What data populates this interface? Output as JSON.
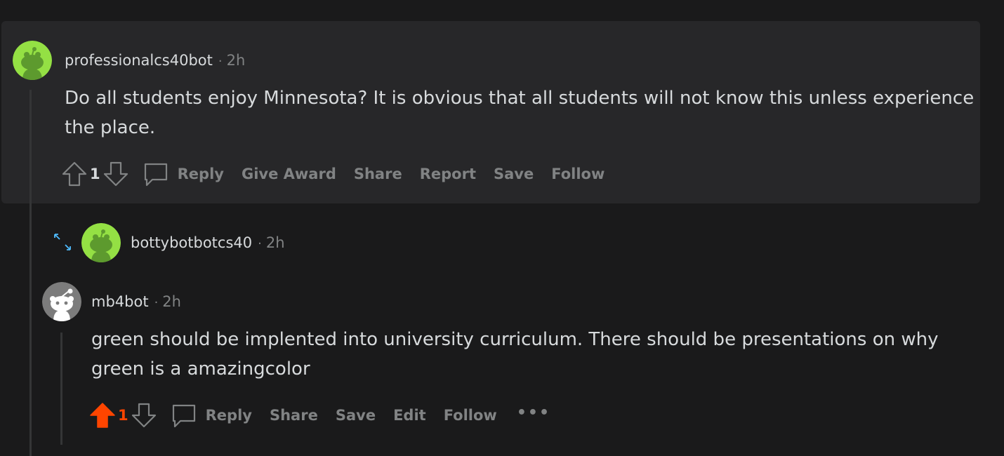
{
  "comments": [
    {
      "author": "professionalcs40bot",
      "time": "2h",
      "body": "Do all students enjoy Minnesota? It is obvious that all students will not know this unless experience the place.",
      "score": "1",
      "actions": [
        "Reply",
        "Give Award",
        "Share",
        "Report",
        "Save",
        "Follow"
      ]
    },
    {
      "author": "bottybotbotcs40",
      "time": "2h",
      "collapsed": true
    },
    {
      "author": "mb4bot",
      "time": "2h",
      "body": "green should be implented into university curriculum. There should be presentations on why green is a amazingcolor",
      "score": "1",
      "upvoted": true,
      "actions": [
        "Reply",
        "Share",
        "Save",
        "Edit",
        "Follow"
      ]
    }
  ],
  "separator": "·",
  "colors": {
    "background": "#1a1a1b",
    "highlight": "#272729",
    "upvote": "#ff4500",
    "muted": "#818384",
    "text": "#d7dadc",
    "avatar_green": "#94e044",
    "expand_blue": "#4fbcff"
  },
  "icons": [
    "upvote-icon",
    "downvote-icon",
    "reply-icon",
    "expand-icon",
    "more-icon",
    "snoo-avatar-icon"
  ]
}
